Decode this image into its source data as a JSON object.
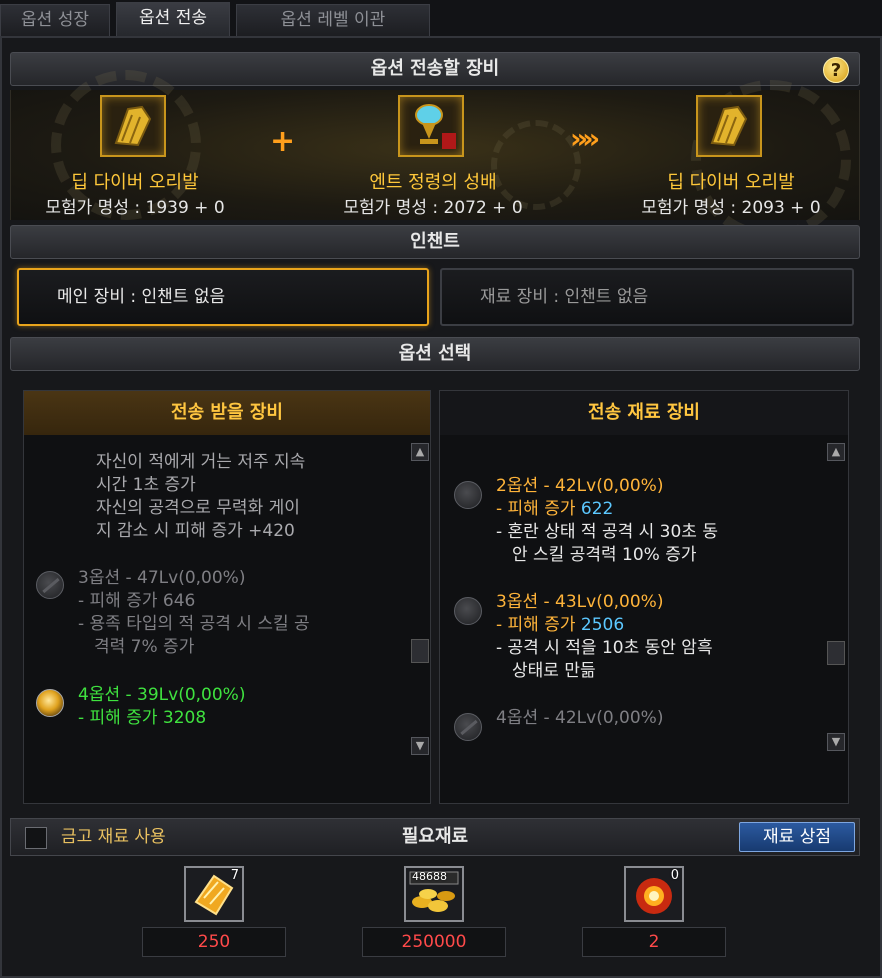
{
  "tabs": [
    {
      "label": "옵션 성장",
      "active": false
    },
    {
      "label": "옵션 전송",
      "active": true
    },
    {
      "label": "옵션 레벨 이관",
      "active": false
    }
  ],
  "sections": {
    "equipment_title": "옵션 전송할 장비",
    "enchant_title": "인챈트",
    "option_select_title": "옵션 선택",
    "help_symbol": "?"
  },
  "equipment": {
    "main": {
      "name": "딥 다이버 오리발",
      "stat": "모험가 명성 : 1939 + 0",
      "icon": "flippers-icon"
    },
    "material": {
      "name": "엔트 정령의 성배",
      "stat": "모험가 명성 : 2072 + 0",
      "icon": "chalice-icon"
    },
    "result": {
      "name": "딥 다이버 오리발",
      "stat": "모험가 명성 : 2093 + 0",
      "icon": "flippers-icon"
    },
    "plus_symbol": "+",
    "arrow_symbol": "»»"
  },
  "enchant": {
    "main": "메인 장비 : 인챈트 없음",
    "material": "재료 장비 : 인챈트 없음"
  },
  "receive_panel": {
    "title": "전송 받을 장비",
    "continued_lines": [
      "자신이 적에게 거는 저주 지속",
      "시간 1초 증가",
      "자신의 공격으로 무력화 게이",
      "지 감소 시 피해 증가 +420"
    ],
    "opt3": {
      "title": "3옵션 - 47Lv(0,00%)",
      "line1": "- 피해 증가 646",
      "line2": "- 용족 타입의 적 공격 시 스킬 공",
      "line3": "격력 7% 증가",
      "state": "disabled"
    },
    "opt4": {
      "title": "4옵션 - 39Lv(0,00%)",
      "line1": "- 피해 증가 3208",
      "state": "selected"
    }
  },
  "material_panel": {
    "title": "전송 재료 장비",
    "opt2": {
      "title": "2옵션 - 42Lv(0,00%)",
      "damage_label": "- 피해 증가 ",
      "damage_value": "622",
      "line2": "- 혼란 상태 적 공격 시 30초 동",
      "line3": "안 스킬 공격력 10% 증가",
      "state": "normal"
    },
    "opt3": {
      "title": "3옵션 - 43Lv(0,00%)",
      "damage_label": "- 피해 증가 ",
      "damage_value": "2506",
      "line2": "- 공격 시 적을 10초 동안 암흑",
      "line3": "상태로 만듦",
      "state": "normal"
    },
    "opt4": {
      "title": "4옵션 - 42Lv(0,00%)",
      "state": "disabled"
    }
  },
  "bottom": {
    "warehouse_label": "금고 재료 사용",
    "required_label": "필요재료",
    "shop_button": "재료 상점",
    "materials": [
      {
        "icon": "gold-crystal-icon",
        "badge": "7",
        "required": "250"
      },
      {
        "icon": "gold-coins-icon",
        "badge": "48688",
        "required": "250000"
      },
      {
        "icon": "burst-orb-icon",
        "badge": "0",
        "required": "2"
      }
    ]
  },
  "colors": {
    "accent_gold": "#ffc640",
    "selected_green": "#3fe23f",
    "value_blue": "#5cc8ff",
    "insufficient_red": "#ff4a4a",
    "shop_blue": "#2c5aa0"
  }
}
